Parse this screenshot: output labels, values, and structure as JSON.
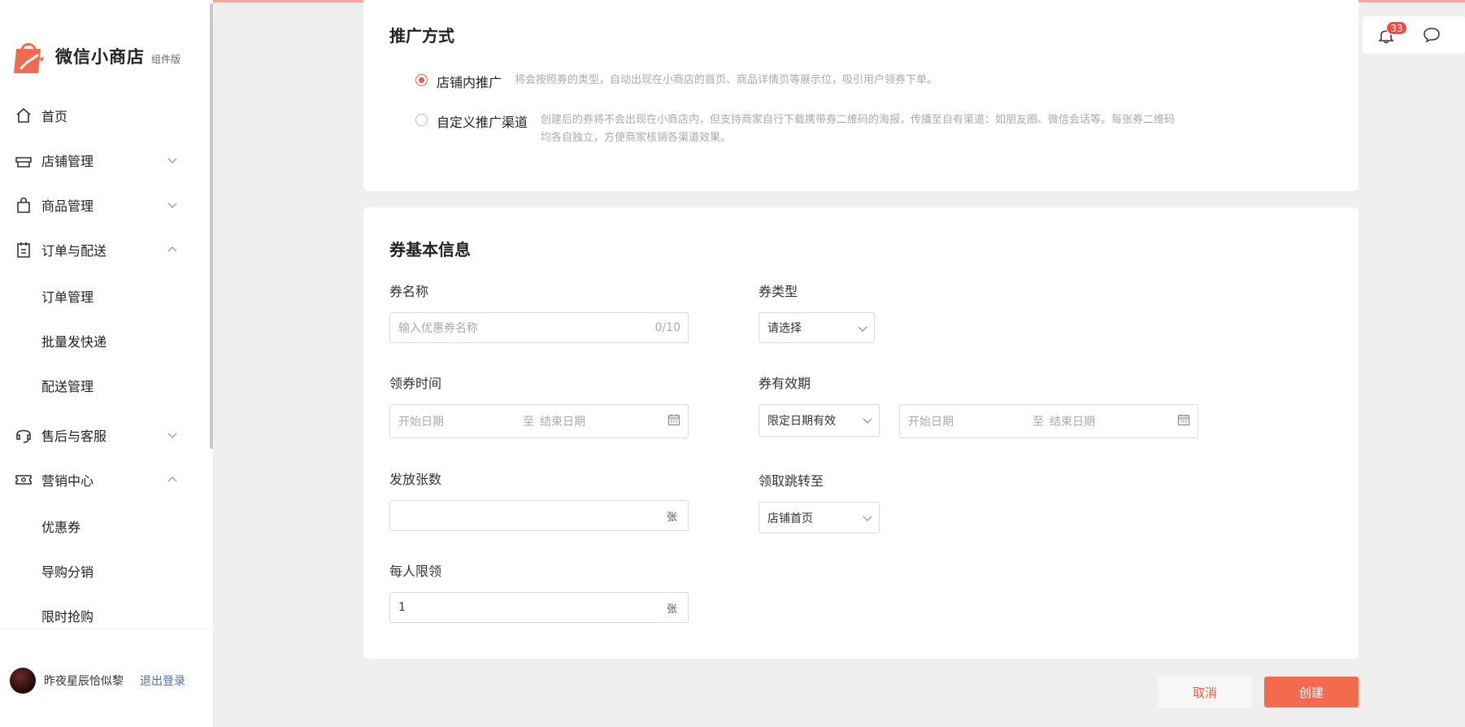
{
  "brand": {
    "name": "微信小商店",
    "tag": "组件版"
  },
  "sidebar": {
    "items": [
      {
        "label": "首页"
      },
      {
        "label": "店铺管理"
      },
      {
        "label": "商品管理"
      },
      {
        "label": "订单与配送"
      },
      {
        "label": "订单管理"
      },
      {
        "label": "批量发快递"
      },
      {
        "label": "配送管理"
      },
      {
        "label": "售后与客服"
      },
      {
        "label": "营销中心"
      },
      {
        "label": "优惠券"
      },
      {
        "label": "导购分销"
      },
      {
        "label": "限时抢购"
      }
    ],
    "user": {
      "name": "昨夜星辰恰似黎",
      "logout": "退出登录"
    }
  },
  "header": {
    "notification_count": "33"
  },
  "promotion": {
    "title": "推广方式",
    "options": [
      {
        "label": "店铺内推广",
        "selected": true,
        "desc": "将会按照券的类型，自动出现在小商店的首页、商品详情页等展示位，吸引用户领券下单。"
      },
      {
        "label": "自定义推广渠道",
        "selected": false,
        "desc": "创建后的券将不会出现在小商店内，但支持商家自行下载携带券二维码的海报，传播至自有渠道：如朋友圈、微信会话等。每张券二维码均各自独立，方便商家核销各渠道效果。"
      }
    ]
  },
  "basic": {
    "title": "券基本信息",
    "name_label": "券名称",
    "name_placeholder": "输入优惠券名称",
    "name_counter": "0/10",
    "type_label": "券类型",
    "type_value": "请选择",
    "claim_time_label": "领券时间",
    "start_placeholder": "开始日期",
    "range_sep": "至",
    "end_placeholder": "结束日期",
    "validity_label": "券有效期",
    "validity_value": "限定日期有效",
    "quantity_label": "发放张数",
    "quantity_value": "",
    "unit": "张",
    "redirect_label": "领取跳转至",
    "redirect_value": "店铺首页",
    "limit_label": "每人限领",
    "limit_value": "1"
  },
  "actions": {
    "cancel": "取消",
    "create": "创建"
  },
  "colors": {
    "accent": "#f05a40",
    "link": "#4a6fb5"
  }
}
